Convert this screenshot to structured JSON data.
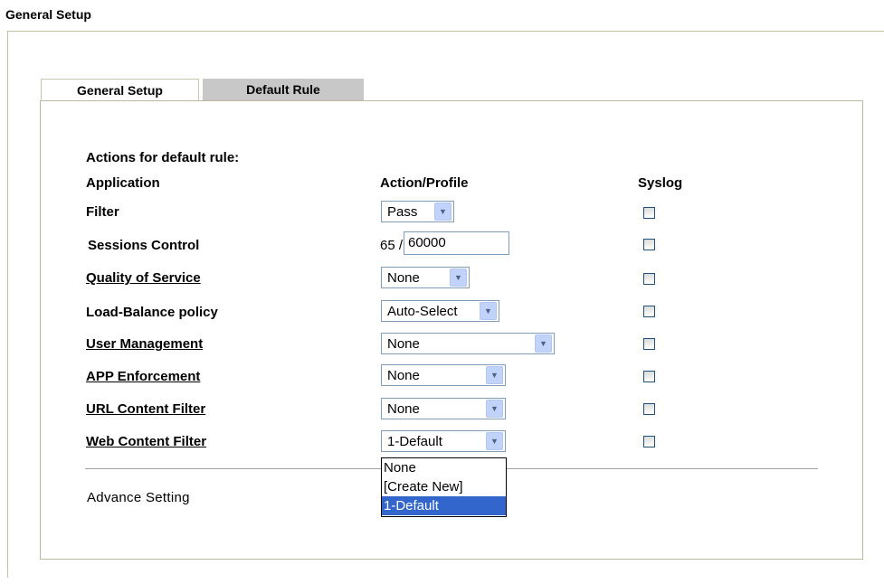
{
  "page": {
    "title": "General Setup"
  },
  "tabs": [
    {
      "label": "General Setup",
      "active": false
    },
    {
      "label": "Default Rule",
      "active": true
    }
  ],
  "section": {
    "title": "Actions for default rule:",
    "headers": {
      "application": "Application",
      "action": "Action/Profile",
      "syslog": "Syslog"
    }
  },
  "rows": {
    "filter": {
      "label": "Filter",
      "value": "Pass",
      "syslog": false
    },
    "sessions": {
      "label": "Sessions Control",
      "current": "65",
      "separator": "/",
      "limit": "60000",
      "syslog": false
    },
    "qos": {
      "label": "Quality of Service",
      "value": "None",
      "syslog": false
    },
    "load_balance": {
      "label": "Load-Balance policy",
      "value": "Auto-Select",
      "syslog": false
    },
    "user_mgmt": {
      "label": "User Management",
      "value": "None",
      "syslog": false
    },
    "app_enforce": {
      "label": "APP Enforcement",
      "value": "None",
      "syslog": false
    },
    "url_filter": {
      "label": "URL Content Filter",
      "value": "None",
      "syslog": false
    },
    "web_filter": {
      "label": "Web Content Filter",
      "value": "1-Default",
      "syslog": false
    }
  },
  "dropdown_open": {
    "options": [
      "None",
      "[Create New]",
      "1-Default"
    ],
    "selected": "1-Default"
  },
  "advance": {
    "label": "Advance Setting"
  },
  "colors": {
    "tab_inactive": "#c8c8c8",
    "dropdown_highlight": "#3366cc",
    "select_border": "#7f9db9"
  },
  "icons": {
    "select_arrow": "chevron-down-icon"
  }
}
